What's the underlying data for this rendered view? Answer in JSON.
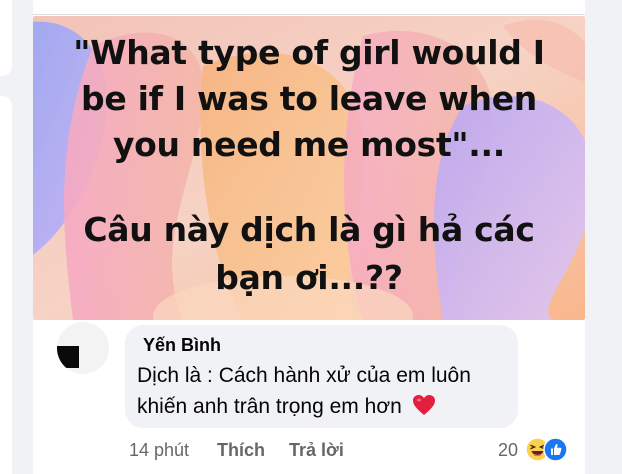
{
  "post": {
    "image": {
      "caption_line1": "\"What type of girl would I",
      "caption_line2": "be if I was to leave when",
      "caption_line3": "you need me most\"...",
      "question_line1": "Câu này dịch là gì hả các",
      "question_line2": "bạn ơi...??"
    }
  },
  "comment": {
    "author": "Yến Bình",
    "text_line1": "Dịch là : Cách hành xử của em luôn",
    "text_line2": "khiến anh trân trọng em hơn",
    "text_emoji_icon": "red-heart-icon",
    "time": "14 phút",
    "like_label": "Thích",
    "reply_label": "Trả lời",
    "reaction_count": "20",
    "reaction_icons": [
      "haha-icon",
      "like-icon"
    ]
  },
  "colors": {
    "page_background": "#f0f2f5",
    "bubble_background": "#f0f2f5",
    "meta_text": "#65676b",
    "like_blue": "#1877f2",
    "heart_red": "#e41e3f"
  }
}
